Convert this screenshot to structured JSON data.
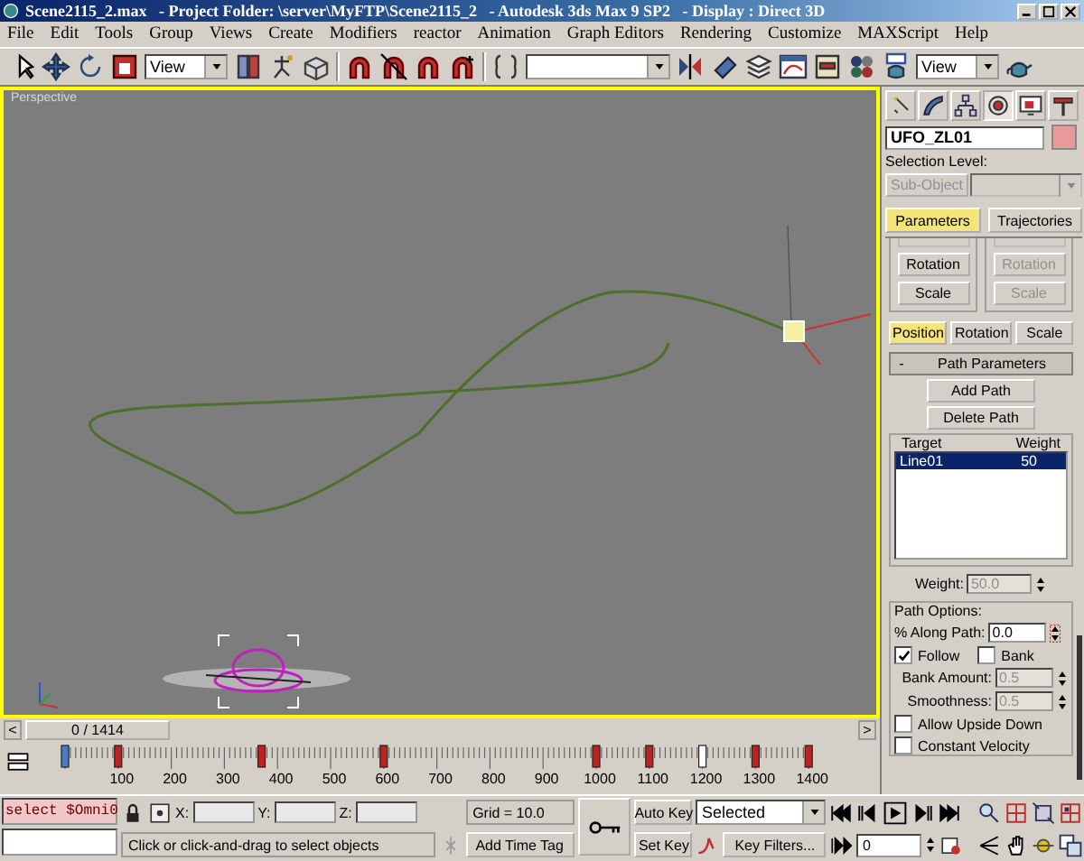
{
  "window": {
    "title": "Scene2115_2.max   - Project Folder: \\server\\MyFTP\\Scene2115_2   - Autodesk 3ds Max 9 SP2   - Display : Direct 3D"
  },
  "menu": [
    "File",
    "Edit",
    "Tools",
    "Group",
    "Views",
    "Create",
    "Modifiers",
    "reactor",
    "Animation",
    "Graph Editors",
    "Rendering",
    "Customize",
    "MAXScript",
    "Help"
  ],
  "toolbar": {
    "coordinate_dropdown": "View",
    "viewport_dropdown": "View"
  },
  "viewport": {
    "label": "Perspective",
    "active": true
  },
  "command_panel": {
    "tabs": [
      {
        "kind": "create",
        "selected": false
      },
      {
        "kind": "modify",
        "selected": false
      },
      {
        "kind": "hierarchy",
        "selected": false
      },
      {
        "kind": "motion",
        "selected": true
      },
      {
        "kind": "display",
        "selected": false
      },
      {
        "kind": "utilities",
        "selected": false
      }
    ],
    "object_name": "UFO_ZL01",
    "color": "#e89a9a",
    "selection_level_label": "Selection Level:",
    "sub_object_button": {
      "label": "Sub-Object",
      "disabled": true
    },
    "mode_buttons": [
      {
        "label": "Parameters",
        "selected": true
      },
      {
        "label": "Trajectories",
        "selected": false
      }
    ],
    "key_buttons": [
      [
        {
          "label": "Rotation",
          "disabled": false
        },
        {
          "label": "Scale",
          "disabled": false
        }
      ],
      [
        {
          "label": "Rotation",
          "disabled": true
        },
        {
          "label": "Scale",
          "disabled": true
        }
      ]
    ],
    "transform_tabs": [
      {
        "label": "Position",
        "selected": true
      },
      {
        "label": "Rotation",
        "selected": false
      },
      {
        "label": "Scale",
        "selected": false
      }
    ],
    "rollout": {
      "toggle": "-",
      "title": "Path Parameters"
    },
    "path_buttons": [
      "Add Path",
      "Delete Path"
    ],
    "target_list": {
      "columns": [
        "Target",
        "Weight"
      ],
      "rows": [
        {
          "target": "Line01",
          "weight": "50",
          "selected": true
        }
      ]
    },
    "weight": {
      "label": "Weight:",
      "value": "50.0",
      "disabled": true
    },
    "path_options": {
      "title": "Path Options:",
      "along_path": {
        "label": "% Along Path:",
        "value": "0.0"
      },
      "checks": [
        {
          "label": "Follow",
          "checked": true
        },
        {
          "label": "Bank",
          "checked": false
        }
      ],
      "spinners": [
        {
          "label": "Bank Amount:",
          "value": "0.5",
          "disabled": true
        },
        {
          "label": "Smoothness:",
          "value": "0.5",
          "disabled": true
        }
      ],
      "options": [
        {
          "label": "Allow Upside Down",
          "checked": false
        },
        {
          "label": "Constant Velocity",
          "checked": false
        }
      ]
    }
  },
  "time_slider": {
    "prev": "<",
    "position": "0 / 1414",
    "next": ">",
    "level": 0
  },
  "track_bar": {
    "ticks": [
      "100",
      "200",
      "300",
      "400",
      "500",
      "600",
      "700",
      "800",
      "900",
      "1000",
      "1100",
      "1200",
      "1300",
      "1400"
    ]
  },
  "status": {
    "listener_input": "select $Omni0",
    "x_label": "X:",
    "y_label": "Y:",
    "z_label": "Z:",
    "grid": "Grid = 10.0",
    "prompt": "Click or click-and-drag to select objects",
    "add_time_tag": "Add Time Tag"
  },
  "animation": {
    "auto_key": "Auto Key",
    "key_filter_set": "Selected",
    "set_key": "Set Key",
    "key_filters": "Key Filters...",
    "current_frame": "0"
  }
}
